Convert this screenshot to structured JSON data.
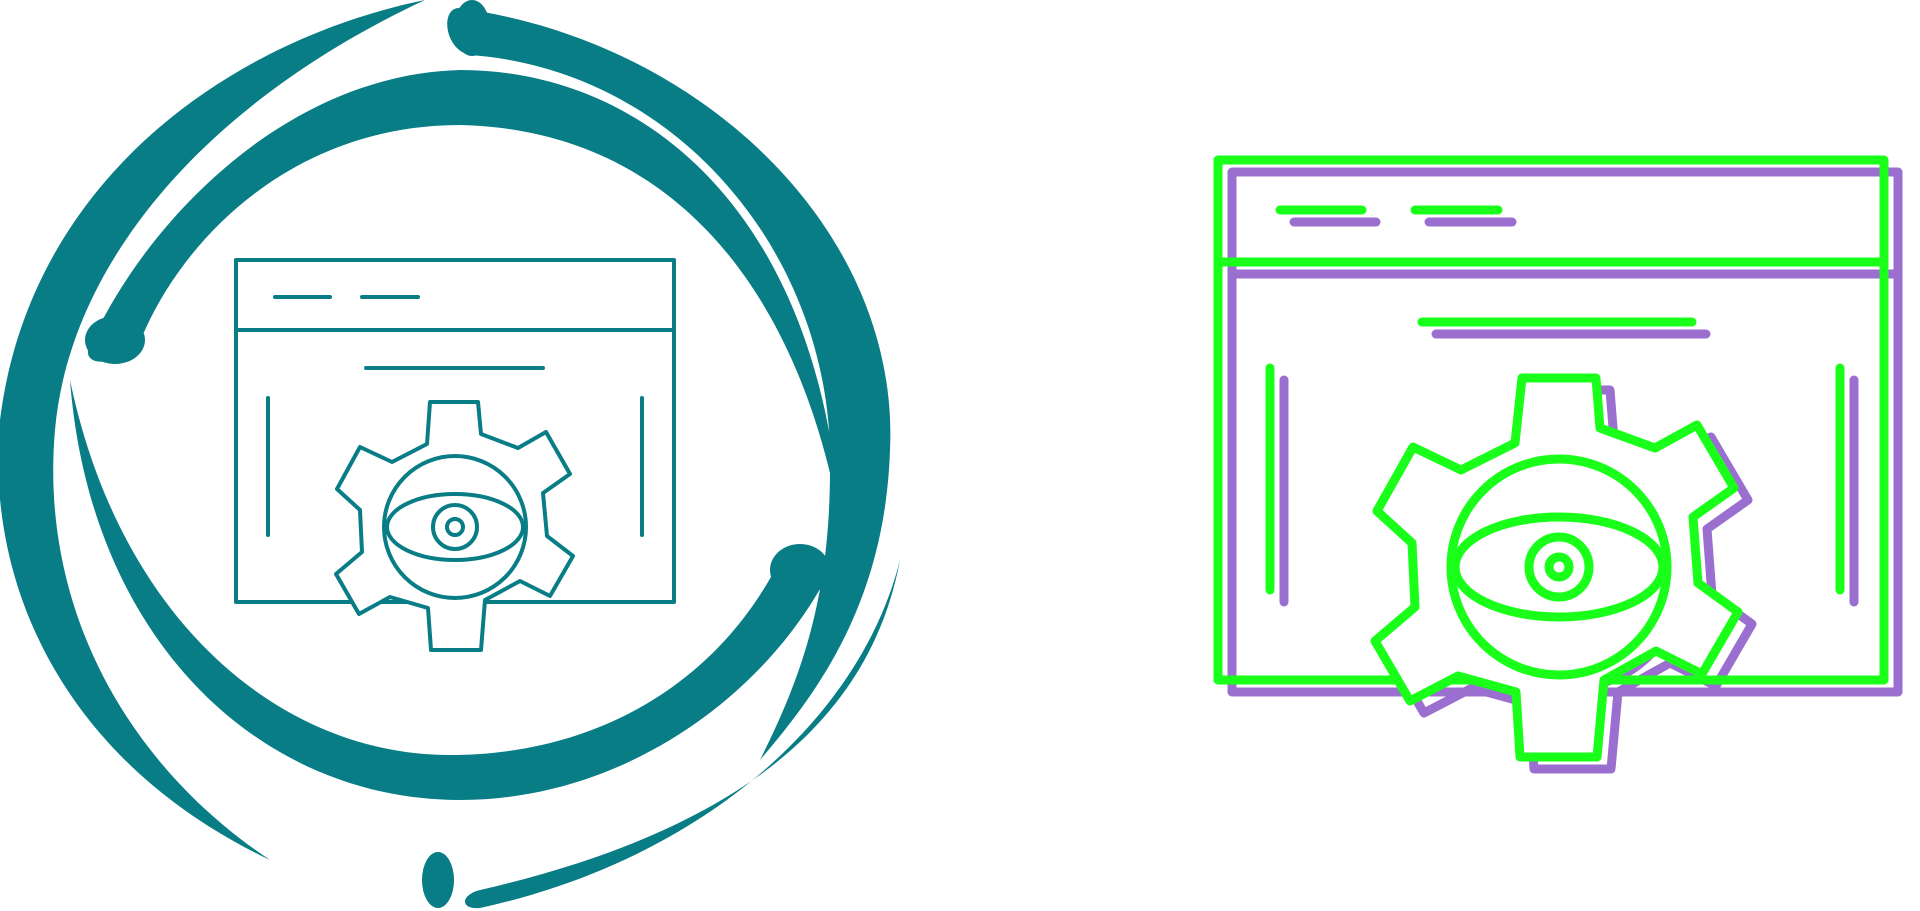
{
  "icons": [
    {
      "name": "web-monitoring-icon",
      "style": "glyph-circular",
      "primary_color": "#087d86"
    },
    {
      "name": "web-monitoring-icon",
      "style": "outline-shadow",
      "primary_color": "#19ff19",
      "shadow_color": "#9a6fd0"
    }
  ]
}
